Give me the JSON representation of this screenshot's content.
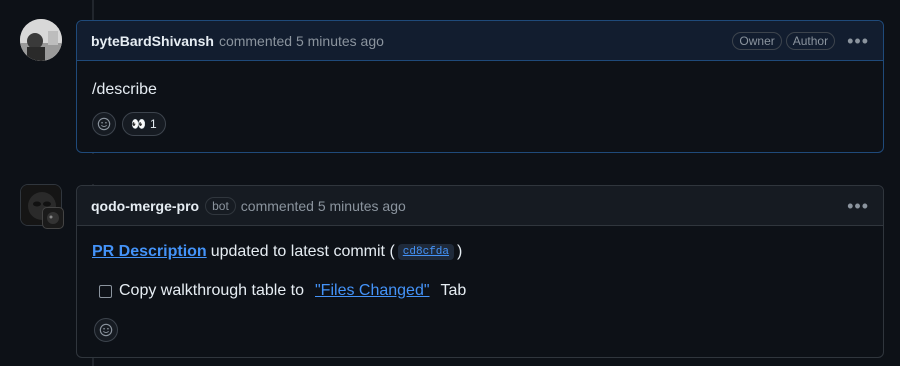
{
  "comment1": {
    "author": "byteBardShivansh",
    "meta": "commented 5 minutes ago",
    "badges": [
      "Owner",
      "Author"
    ],
    "more_icon": "kebab-horizontal-icon",
    "body": "/describe",
    "reactions": {
      "add_icon": "smiley-icon",
      "eyes": {
        "emoji": "👀",
        "count": "1"
      }
    }
  },
  "comment2": {
    "author": "qodo-merge-pro",
    "bot_badge": "bot",
    "meta": "commented 5 minutes ago",
    "more_icon": "kebab-horizontal-icon",
    "line1": {
      "link": "PR Description",
      "text": "updated to latest commit (",
      "commit": "cd8cfda",
      "close": ")"
    },
    "checkbox": {
      "before": "Copy walkthrough table to",
      "link": "\"Files Changed\"",
      "after": "Tab",
      "checked": false
    },
    "add_reaction_icon": "smiley-icon"
  },
  "colors": {
    "background": "#0d1117",
    "link": "#4493f8",
    "muted": "#8b949e",
    "highlight_border": "#1f4a7a"
  }
}
